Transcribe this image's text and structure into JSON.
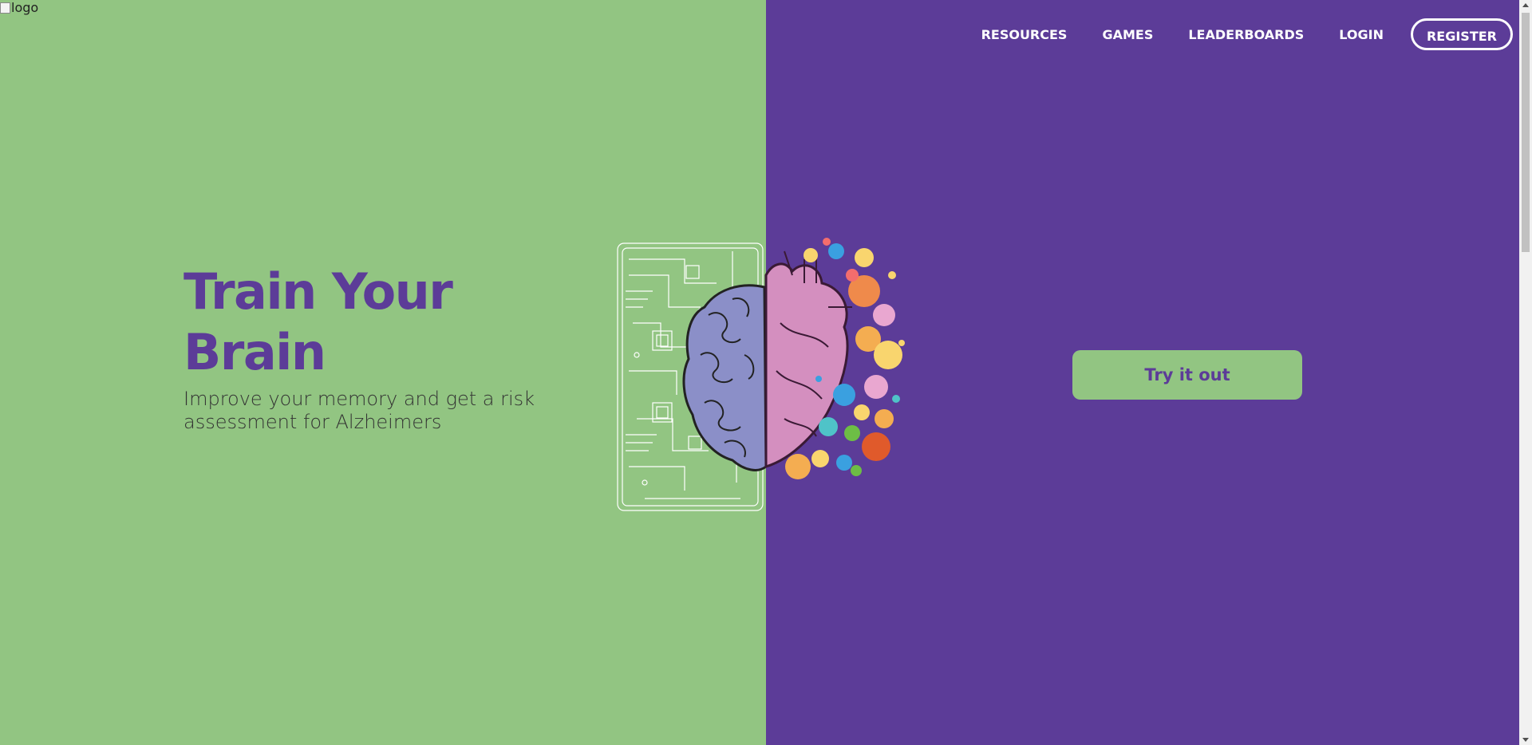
{
  "logo": {
    "alt": "logo"
  },
  "nav": {
    "items": [
      {
        "label": "RESOURCES"
      },
      {
        "label": "GAMES"
      },
      {
        "label": "LEADERBOARDS"
      },
      {
        "label": "LOGIN"
      }
    ],
    "register_label": "REGISTER"
  },
  "hero": {
    "title": "Train Your Brain",
    "subtitle": "Improve your memory and get a risk assessment for Alzheimers",
    "cta_label": "Try it out"
  },
  "illustration": {
    "icon": "brain-heart-illustration"
  },
  "colors": {
    "green": "#92c582",
    "purple": "#5c3c98",
    "white": "#ffffff"
  }
}
